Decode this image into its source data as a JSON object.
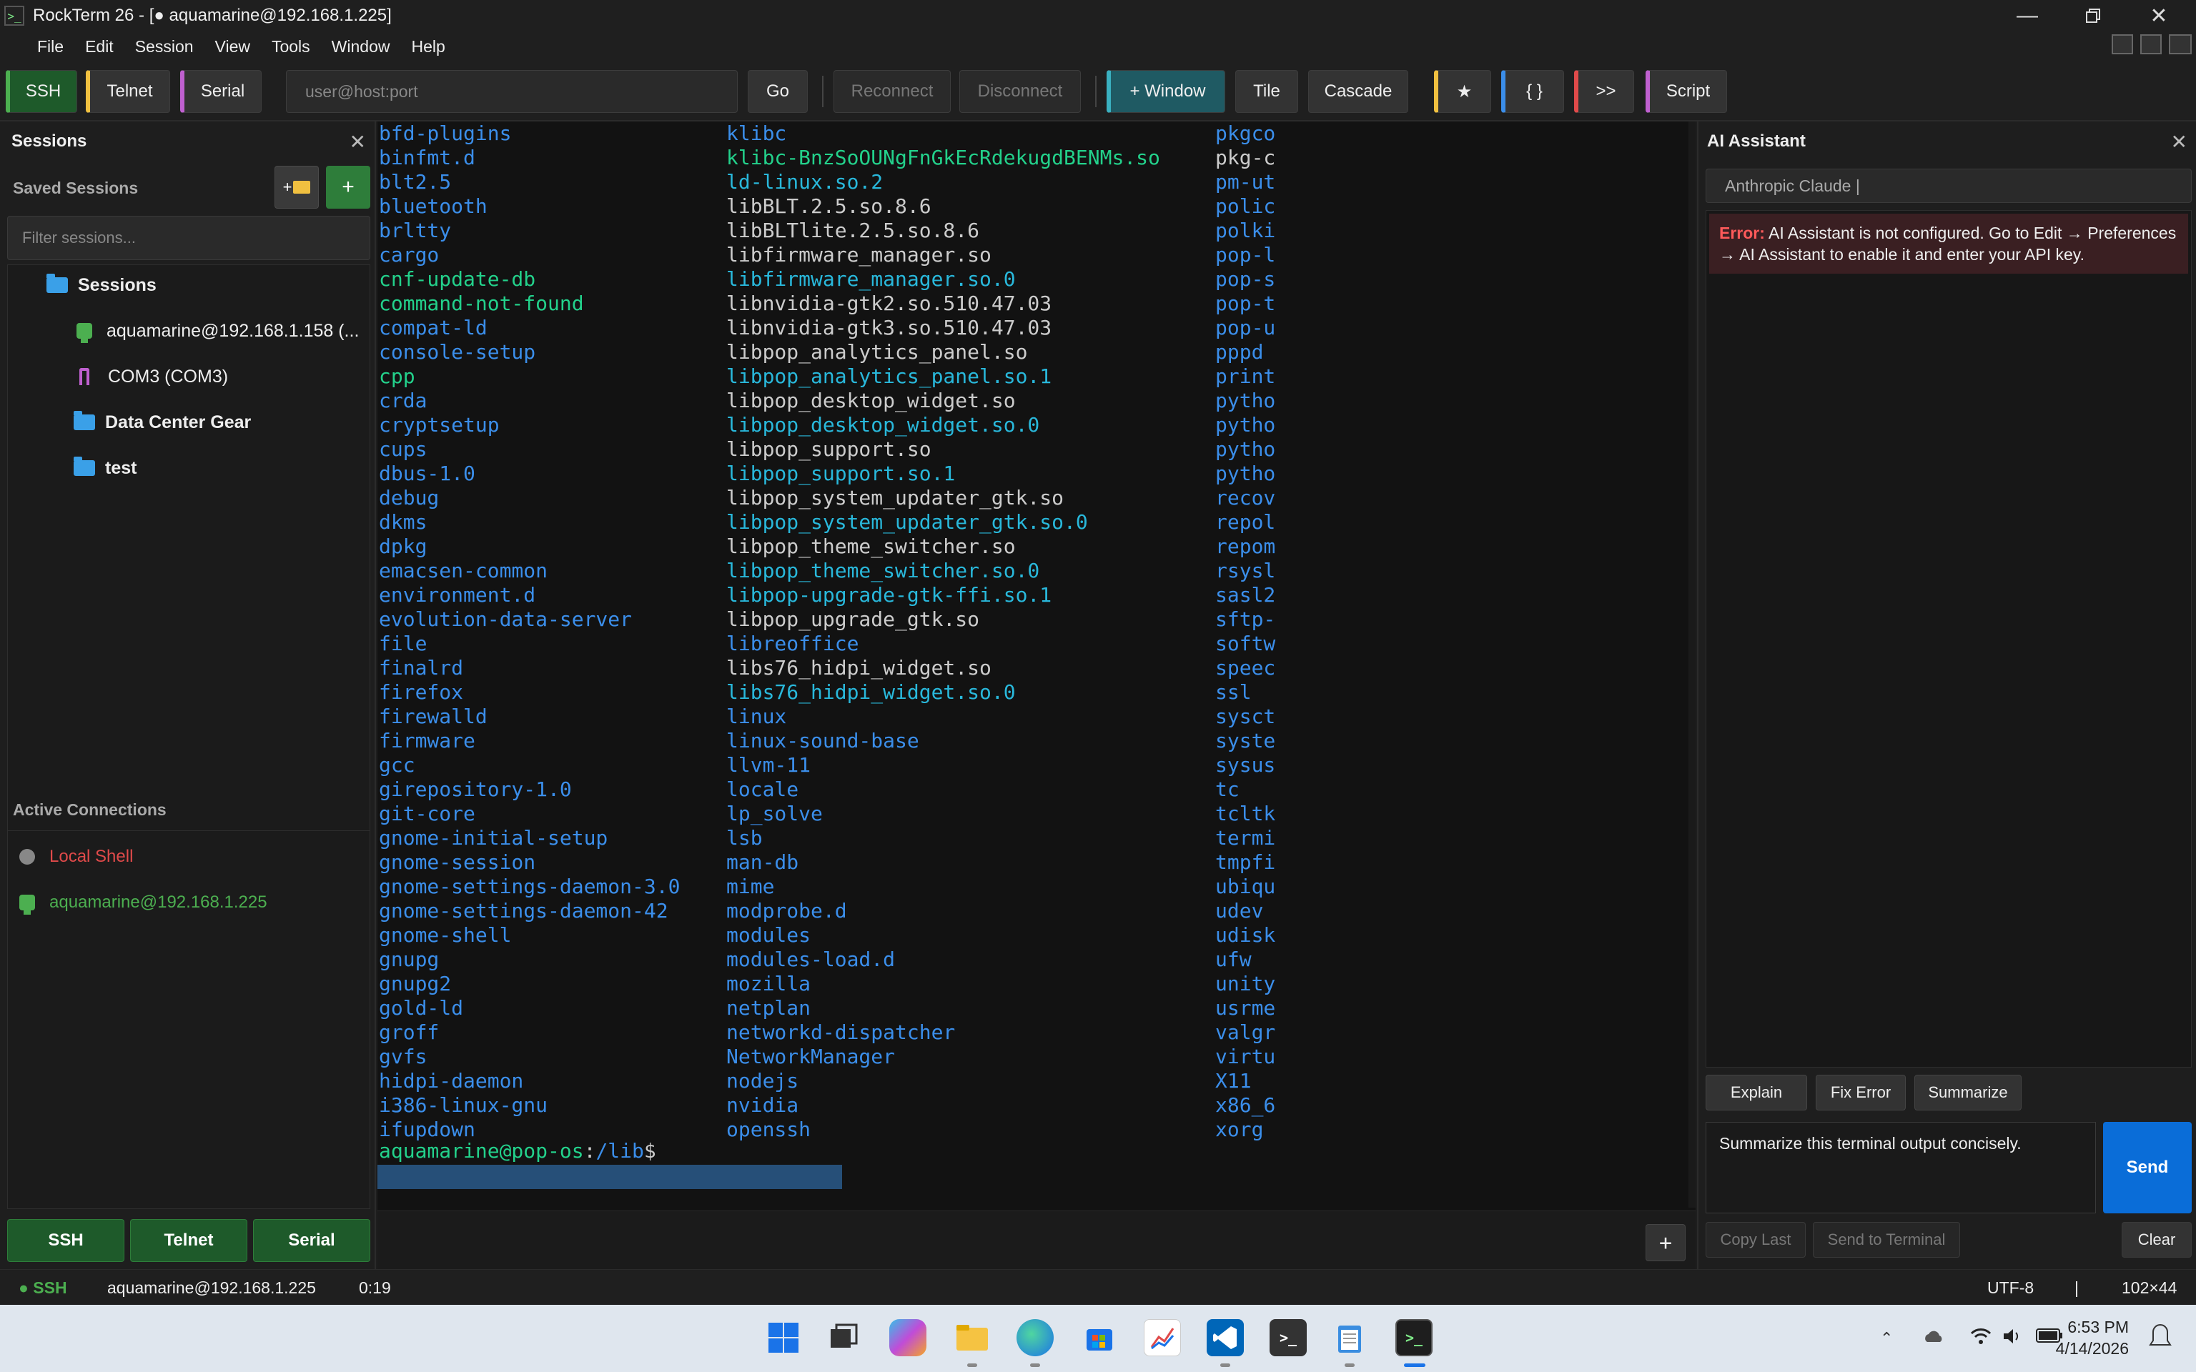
{
  "window": {
    "title": "RockTerm 26 - [● aquamarine@192.168.1.225]",
    "app_icon": ">_"
  },
  "menu": [
    "File",
    "Edit",
    "Session",
    "View",
    "Tools",
    "Window",
    "Help"
  ],
  "toolbar": {
    "ssh": "SSH",
    "telnet": "Telnet",
    "serial": "Serial",
    "host_placeholder": "user@host:port",
    "go": "Go",
    "reconnect": "Reconnect",
    "disconnect": "Disconnect",
    "new_window": "+ Window",
    "tile": "Tile",
    "cascade": "Cascade",
    "star": "★",
    "braces": "{ }",
    "send_all": ">>",
    "script": "Script",
    "accent_ssh": "#4caf50",
    "accent_telnet": "#f0c040",
    "accent_serial": "#c060d0"
  },
  "sidebar": {
    "title": "Sessions",
    "saved_label": "Saved Sessions",
    "filter_placeholder": "Filter sessions...",
    "tree": {
      "root": "Sessions",
      "items": [
        {
          "label": "aquamarine@192.168.1.158 (...",
          "icon": "ssh-session-icon"
        },
        {
          "label": "COM3 (COM3)",
          "icon": "serial-port-icon"
        },
        {
          "label": "Data Center Gear",
          "icon": "folder-icon"
        },
        {
          "label": "test",
          "icon": "folder-icon"
        }
      ]
    },
    "active_label": "Active Connections",
    "active": [
      {
        "label": "Local Shell",
        "color": "#e04a4a"
      },
      {
        "label": "aquamarine@192.168.1.225",
        "color": "#4caf50"
      }
    ],
    "bottom_buttons": [
      "SSH",
      "Telnet",
      "Serial"
    ]
  },
  "terminal": {
    "col1": [
      "bfd-plugins",
      "binfmt.d",
      "blt2.5",
      "bluetooth",
      "brltty",
      "cargo",
      "cnf-update-db",
      "command-not-found",
      "compat-ld",
      "console-setup",
      "cpp",
      "crda",
      "cryptsetup",
      "cups",
      "dbus-1.0",
      "debug",
      "dkms",
      "dpkg",
      "emacsen-common",
      "environment.d",
      "evolution-data-server",
      "file",
      "finalrd",
      "firefox",
      "firewalld",
      "firmware",
      "gcc",
      "girepository-1.0",
      "git-core",
      "gnome-initial-setup",
      "gnome-session",
      "gnome-settings-daemon-3.0",
      "gnome-settings-daemon-42",
      "gnome-shell",
      "gnupg",
      "gnupg2",
      "gold-ld",
      "groff",
      "gvfs",
      "hidpi-daemon",
      "i386-linux-gnu",
      "ifupdown"
    ],
    "col1_types": [
      "d",
      "d",
      "d",
      "d",
      "d",
      "d",
      "g",
      "g",
      "d",
      "d",
      "g",
      "d",
      "d",
      "d",
      "d",
      "d",
      "d",
      "d",
      "d",
      "d",
      "d",
      "d",
      "d",
      "d",
      "d",
      "d",
      "d",
      "d",
      "d",
      "d",
      "d",
      "d",
      "d",
      "d",
      "d",
      "d",
      "d",
      "d",
      "d",
      "d",
      "d",
      "d"
    ],
    "col2": [
      "klibc",
      "klibc-BnzSoOUNgFnGkEcRdekugdBENMs.so",
      "ld-linux.so.2",
      "libBLT.2.5.so.8.6",
      "libBLTlite.2.5.so.8.6",
      "libfirmware_manager.so",
      "libfirmware_manager.so.0",
      "libnvidia-gtk2.so.510.47.03",
      "libnvidia-gtk3.so.510.47.03",
      "libpop_analytics_panel.so",
      "libpop_analytics_panel.so.1",
      "libpop_desktop_widget.so",
      "libpop_desktop_widget.so.0",
      "libpop_support.so",
      "libpop_support.so.1",
      "libpop_system_updater_gtk.so",
      "libpop_system_updater_gtk.so.0",
      "libpop_theme_switcher.so",
      "libpop_theme_switcher.so.0",
      "libpop-upgrade-gtk-ffi.so.1",
      "libpop_upgrade_gtk.so",
      "libreoffice",
      "libs76_hidpi_widget.so",
      "libs76_hidpi_widget.so.0",
      "linux",
      "linux-sound-base",
      "llvm-11",
      "locale",
      "lp_solve",
      "lsb",
      "man-db",
      "mime",
      "modprobe.d",
      "modules",
      "modules-load.d",
      "mozilla",
      "netplan",
      "networkd-dispatcher",
      "NetworkManager",
      "nodejs",
      "nvidia",
      "openssh"
    ],
    "col2_types": [
      "d",
      "g",
      "c",
      "f",
      "f",
      "f",
      "c",
      "f",
      "f",
      "f",
      "c",
      "f",
      "c",
      "f",
      "c",
      "f",
      "c",
      "f",
      "c",
      "c",
      "f",
      "d",
      "f",
      "c",
      "d",
      "d",
      "d",
      "d",
      "d",
      "d",
      "d",
      "d",
      "d",
      "d",
      "d",
      "d",
      "d",
      "d",
      "d",
      "d",
      "d",
      "d"
    ],
    "col3": [
      "pkgco",
      "pkg-c",
      "pm-ut",
      "polic",
      "polki",
      "pop-l",
      "pop-s",
      "pop-t",
      "pop-u",
      "pppd",
      "print",
      "pytho",
      "pytho",
      "pytho",
      "pytho",
      "recov",
      "repol",
      "repom",
      "rsysl",
      "sasl2",
      "sftp-",
      "softw",
      "speec",
      "ssl",
      "sysct",
      "syste",
      "sysus",
      "tc",
      "tcltk",
      "termi",
      "tmpfi",
      "ubiqu",
      "udev",
      "udisk",
      "ufw",
      "unity",
      "usrme",
      "valgr",
      "virtu",
      "X11",
      "x86_6",
      "xorg"
    ],
    "col3_types": [
      "d",
      "f",
      "d",
      "d",
      "d",
      "d",
      "d",
      "d",
      "d",
      "d",
      "d",
      "d",
      "d",
      "d",
      "d",
      "d",
      "d",
      "d",
      "d",
      "d",
      "d",
      "d",
      "d",
      "d",
      "d",
      "d",
      "d",
      "d",
      "d",
      "d",
      "d",
      "d",
      "d",
      "d",
      "d",
      "d",
      "d",
      "d",
      "d",
      "d",
      "d",
      "d"
    ],
    "prompt_user": "aquamarine@pop-os",
    "prompt_sep": ":",
    "prompt_path": "/lib",
    "prompt_end": "$",
    "add_tab": "+"
  },
  "ai": {
    "title": "AI Assistant",
    "provider": "Anthropic Claude  |",
    "error_label": "Error:",
    "error_text": " AI Assistant is not configured. Go to Edit → Preferences → AI Assistant to enable it and enter your API key.",
    "actions": [
      "Explain",
      "Fix Error",
      "Summarize"
    ],
    "input_value": "Summarize this terminal output concisely.",
    "send": "Send",
    "copy_last": "Copy Last",
    "send_to_terminal": "Send to Terminal",
    "clear": "Clear"
  },
  "status": {
    "proto": "● SSH",
    "host": "aquamarine@192.168.1.225",
    "elapsed": "0:19",
    "encoding": "UTF-8",
    "sep": "|",
    "size": "102×44"
  },
  "taskbar": {
    "time": "6:53 PM",
    "date": "4/14/2026"
  }
}
